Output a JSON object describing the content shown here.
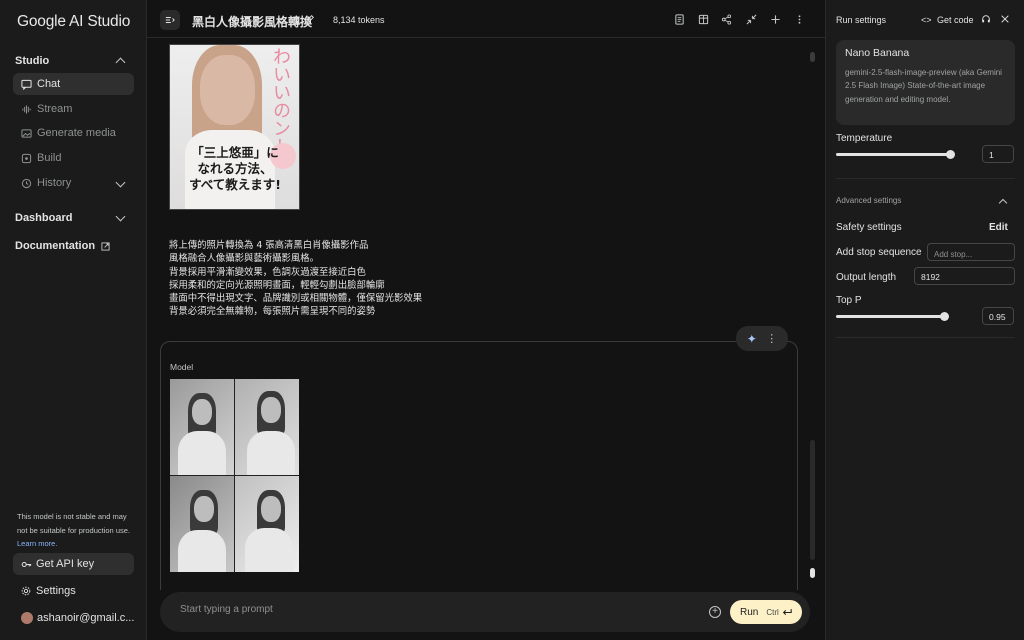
{
  "sidebar": {
    "logo": "Google AI Studio",
    "studio_heading": "Studio",
    "items": [
      {
        "label": "Chat"
      },
      {
        "label": "Stream"
      },
      {
        "label": "Generate media"
      },
      {
        "label": "Build"
      },
      {
        "label": "History"
      }
    ],
    "dashboard_heading": "Dashboard",
    "documentation_label": "Documentation",
    "notice_text": "This model is not stable and may not be suitable for production use.",
    "learn_more": "Learn more.",
    "api_key_label": "Get API key",
    "settings_label": "Settings",
    "user_email": "ashanoir@gmail.c..."
  },
  "topbar": {
    "title": "黑白人像攝影風格轉換",
    "tokens": "8,134 tokens"
  },
  "chat": {
    "cover": {
      "top_text": "わいいのント",
      "main_text_lines": [
        "「三上悠亜」に",
        "なれる方法、",
        "すべて教えます!"
      ]
    },
    "prompt_lines": [
      "將上傳的照片轉換為 4 張高清黑白肖像攝影作品",
      "風格融合人像攝影與藝術攝影風格。",
      "背景採用平滑漸變效果，色調灰過渡至接近白色",
      "採用柔和的定向光源照明畫面，輕輕勾劃出臉部輪廓",
      "畫面中不得出現文字、品牌識別或相關物體，僅保留光影效果",
      "背景必須完全無雜物，每張照片需呈現不同的姿勢"
    ],
    "model_label": "Model"
  },
  "input": {
    "placeholder": "Start typing a prompt",
    "run_label": "Run",
    "shortcut": "Ctrl"
  },
  "run_settings": {
    "title": "Run settings",
    "get_code": "Get code",
    "model_name": "Nano Banana",
    "model_desc": "gemini-2.5-flash-image-preview (aka Gemini 2.5 Flash Image) State-of-the-art image generation and editing model.",
    "temperature_label": "Temperature",
    "temperature_value": "1",
    "temperature_level": 0.95,
    "advanced_label": "Advanced settings",
    "safety_label": "Safety settings",
    "edit_label": "Edit",
    "stop_seq_label": "Add stop sequence",
    "stop_seq_placeholder": "Add stop...",
    "output_length_label": "Output length",
    "output_length_value": "8192",
    "top_p_label": "Top P",
    "top_p_value": "0.95",
    "top_p_level": 0.95
  }
}
